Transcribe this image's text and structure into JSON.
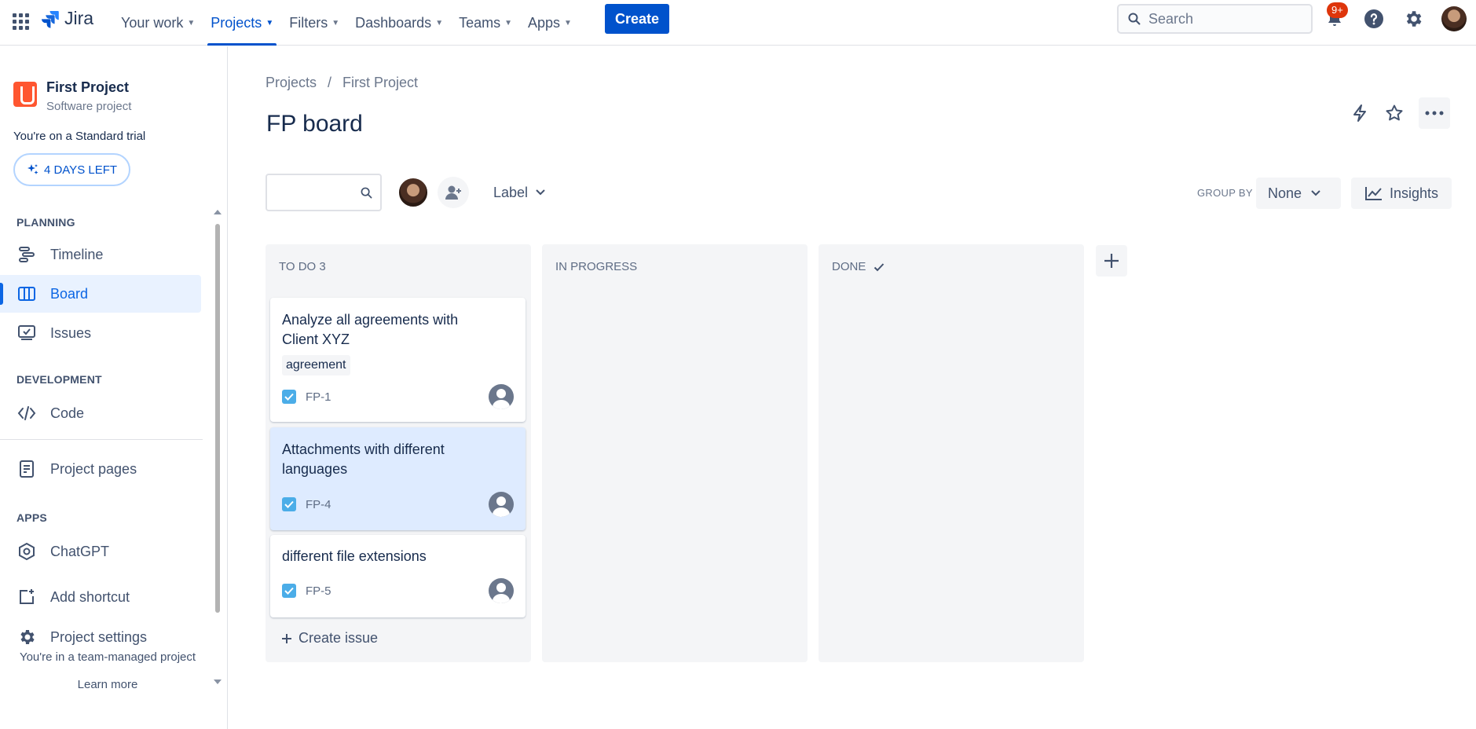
{
  "topnav": {
    "logo_text": "Jira",
    "items": [
      {
        "label": "Your work"
      },
      {
        "label": "Projects"
      },
      {
        "label": "Filters"
      },
      {
        "label": "Dashboards"
      },
      {
        "label": "Teams"
      },
      {
        "label": "Apps"
      }
    ],
    "create_label": "Create",
    "search_placeholder": "Search",
    "notification_badge": "9+",
    "brand_color": "#0052cc"
  },
  "sidebar": {
    "project_name": "First Project",
    "project_type": "Software project",
    "trial_text": "You're on a Standard trial",
    "trial_button": "4 DAYS LEFT",
    "planning_header": "PLANNING",
    "planning_items": [
      {
        "label": "Timeline",
        "icon": "timeline-icon"
      },
      {
        "label": "Board",
        "icon": "board-icon",
        "active": true
      },
      {
        "label": "Issues",
        "icon": "issues-icon"
      }
    ],
    "development_header": "DEVELOPMENT",
    "code_label": "Code",
    "project_pages_label": "Project pages",
    "apps_header": "APPS",
    "chatgpt_label": "ChatGPT",
    "add_shortcut_label": "Add shortcut",
    "project_settings_label": "Project settings",
    "team_note": "You're in a team-managed project",
    "learn_more": "Learn more"
  },
  "main": {
    "breadcrumb": [
      "Projects",
      "/",
      "First Project"
    ],
    "title": "FP board",
    "label_filter": "Label",
    "group_by_label": "GROUP BY",
    "group_by_value": "None",
    "insights_label": "Insights"
  },
  "columns": [
    {
      "title": "TO DO 3",
      "cards": [
        {
          "title": "Analyze all agreements with Client XYZ",
          "label": "agreement",
          "key": "FP-1"
        },
        {
          "title": "Attachments with different languages",
          "key": "FP-4",
          "selected": true
        },
        {
          "title": "different file extensions",
          "key": "FP-5"
        }
      ],
      "create_issue": "Create issue"
    },
    {
      "title": "IN PROGRESS",
      "cards": []
    },
    {
      "title": "DONE",
      "cards": []
    }
  ]
}
